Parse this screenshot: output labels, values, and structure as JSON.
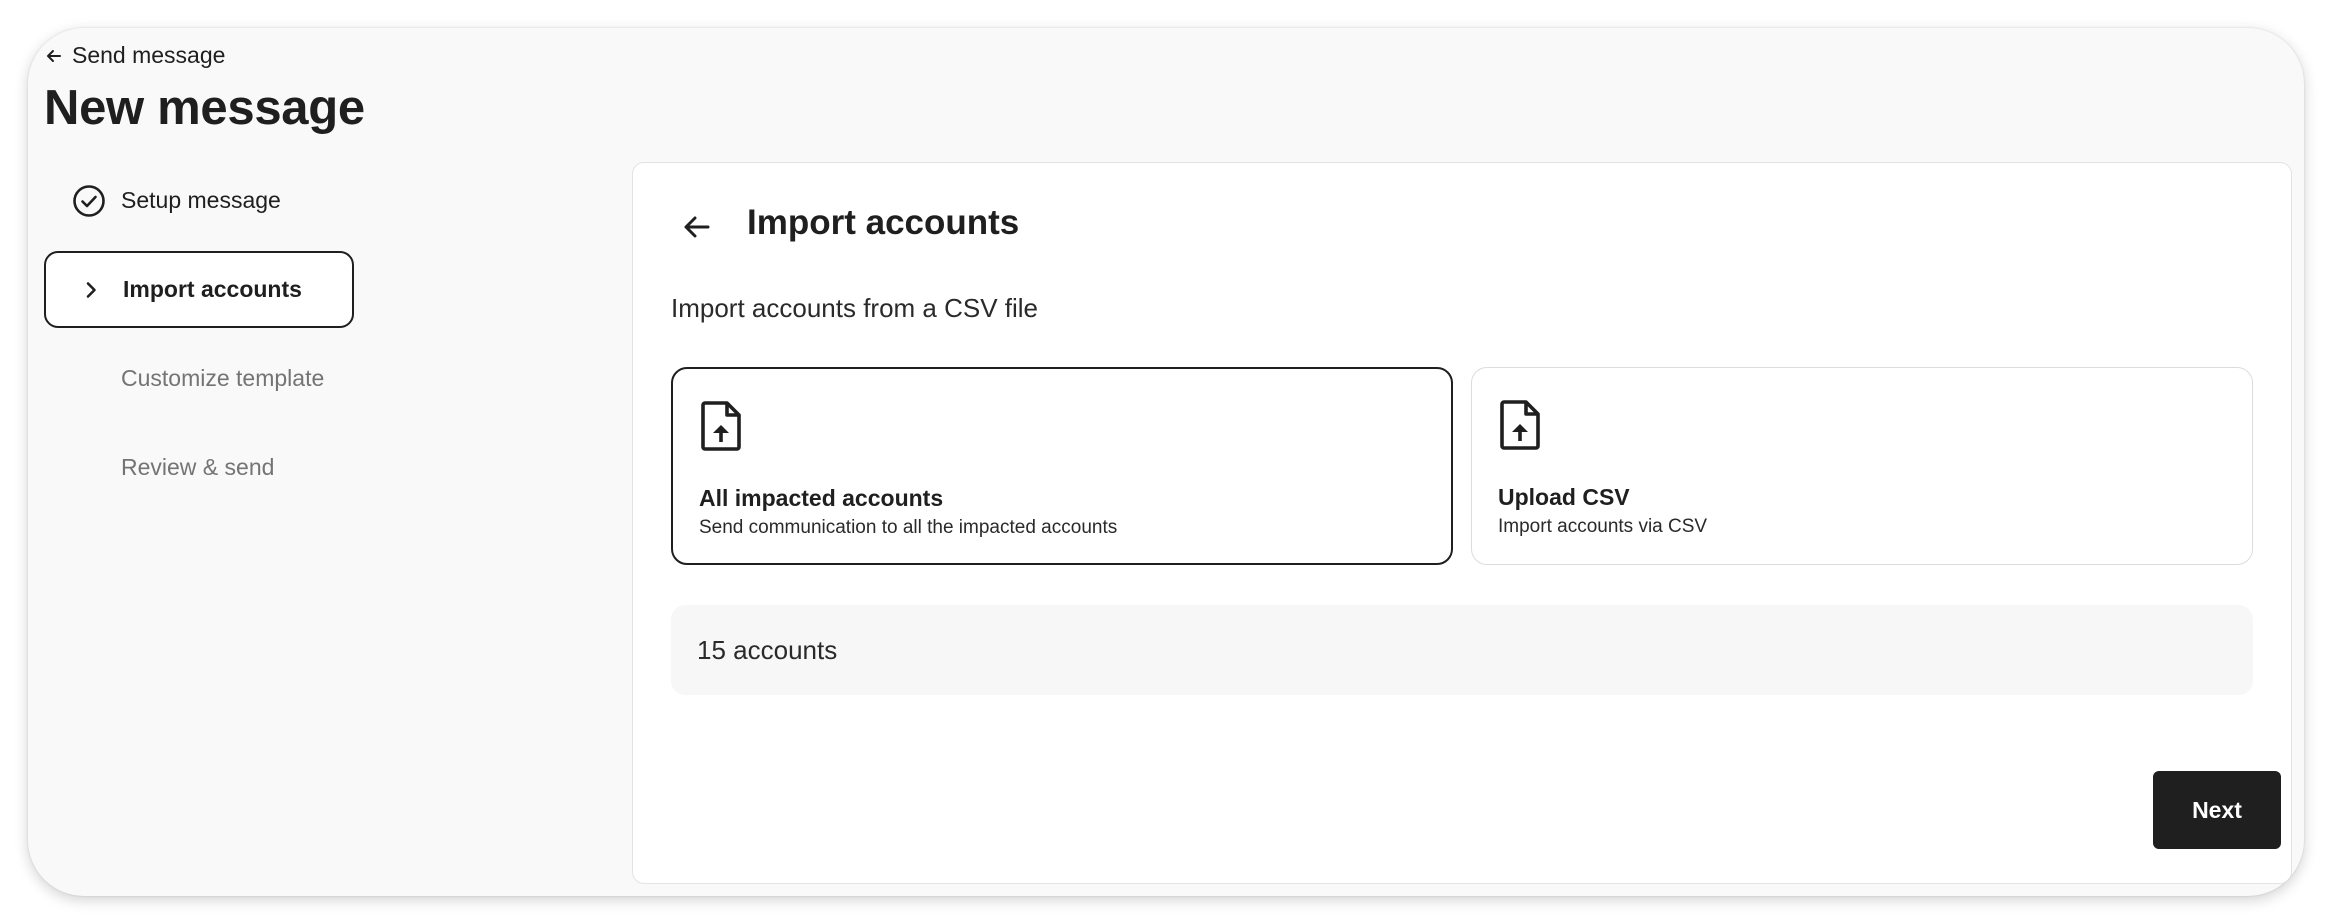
{
  "header": {
    "back_label": "Send message",
    "title": "New message"
  },
  "steps": [
    {
      "label": "Setup message",
      "state": "done",
      "icon": "check-circle-icon"
    },
    {
      "label": "Import accounts",
      "state": "active",
      "icon": "chevron-right-icon"
    },
    {
      "label": "Customize template",
      "state": "pending"
    },
    {
      "label": "Review & send",
      "state": "pending"
    }
  ],
  "panel": {
    "title": "Import accounts",
    "subtitle": "Import accounts from a CSV file",
    "options": [
      {
        "title": "All impacted accounts",
        "description": "Send communication to all the impacted accounts",
        "selected": true,
        "icon": "file-upload-icon"
      },
      {
        "title": "Upload CSV",
        "description": "Import accounts via CSV",
        "selected": false,
        "icon": "file-upload-icon"
      }
    ],
    "count_text": "15 accounts",
    "next_label": "Next"
  },
  "colors": {
    "primary": "#1f1f1f",
    "background": "#f9f9f9",
    "muted_text": "#747474"
  }
}
